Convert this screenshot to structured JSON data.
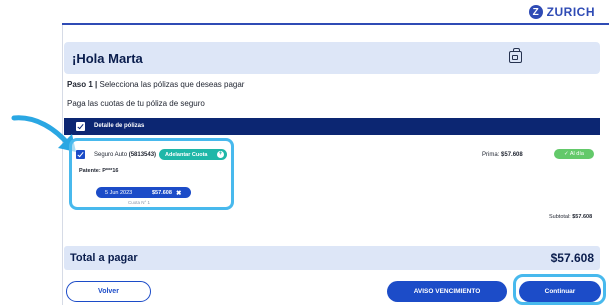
{
  "header": {
    "logo_text": "ZURICH",
    "logo_mark": "Z",
    "brand_color": "#2f4bb5"
  },
  "greeting": {
    "text": "¡Hola Marta",
    "icon": "id-card-icon"
  },
  "step": {
    "label": "Paso 1 |",
    "text": " Selecciona las pólizas que deseas pagar"
  },
  "subtitle": "Paga las cuotas de tu póliza de seguro",
  "table": {
    "header_label": "Detalle de pólizas",
    "header_color": "#0c2672"
  },
  "policy": {
    "name": "Seguro Auto ",
    "number": "(5813543)",
    "advance_button": "Adelantar Cuota",
    "plate_label": "Patente: P***16",
    "installment": {
      "date": "5 Jun 2023",
      "amount": "$57.608",
      "remove": "✖",
      "number_label": "Cuota N° 1"
    },
    "premium_label": "Prima: ",
    "premium_value": "$57.608",
    "status": "✓  Al día",
    "subtotal_label": "Subtotal: ",
    "subtotal_value": "$57.608"
  },
  "total": {
    "label": "Total a pagar",
    "amount": "$57.608"
  },
  "buttons": {
    "back": "Volver",
    "notice": "AVISO VENCIMIENTO",
    "continue": "Continuar"
  },
  "highlight_color": "#48b9ed"
}
